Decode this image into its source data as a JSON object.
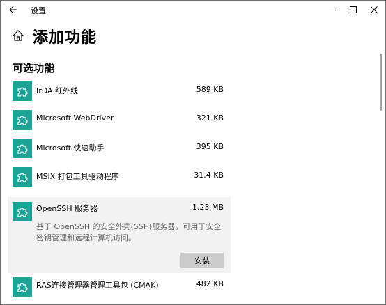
{
  "window": {
    "title": "设置"
  },
  "header": {
    "page_title": "添加功能",
    "section_title": "可选功能"
  },
  "features": [
    {
      "name": "IrDA 红外线",
      "size": "589 KB"
    },
    {
      "name": "Microsoft WebDriver",
      "size": "321 KB"
    },
    {
      "name": "Microsoft 快速助手",
      "size": "395 KB"
    },
    {
      "name": "MSIX 打包工具驱动程序",
      "size": "31.4 KB"
    },
    {
      "name": "OpenSSH 服务器",
      "size": "1.23 MB"
    },
    {
      "name": "RAS连接管理器管理工具包 (CMAK)",
      "size": "482 KB"
    }
  ],
  "expanded_feature": {
    "description": "基于 OpenSSH 的安全外壳(SSH)服务器，可用于安全密钥管理和远程计算机访问。",
    "install_label": "安装"
  },
  "colors": {
    "accent_tile": "#1ba495",
    "expanded_bg": "#f2f2f2",
    "install_button_bg": "#cccccc",
    "description_text": "#666666"
  },
  "icons": {
    "back": "back-arrow-icon",
    "home": "home-icon",
    "feature": "puzzle-piece-icon",
    "minimize": "minimize-icon",
    "maximize": "maximize-icon",
    "close": "close-icon"
  }
}
